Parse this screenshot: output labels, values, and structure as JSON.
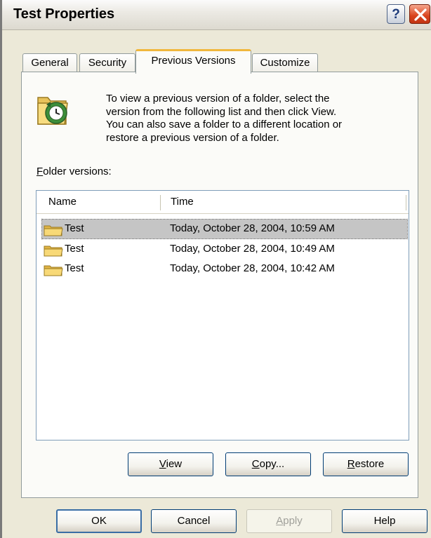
{
  "window": {
    "title": "Test Properties",
    "help_glyph": "?"
  },
  "tabs": [
    {
      "label": "General",
      "active": false
    },
    {
      "label": "Security",
      "active": false
    },
    {
      "label": "Previous Versions",
      "active": true
    },
    {
      "label": "Customize",
      "active": false
    }
  ],
  "panel": {
    "description_lines": [
      "To view a previous version of a folder, select the",
      "version from the following list and then click View.",
      "You can also save a folder to a different location or",
      "restore a previous version of a folder."
    ],
    "folder_versions_label_hotkey": "F",
    "folder_versions_label_rest": "older versions:",
    "columns": [
      "Name",
      "Time"
    ],
    "rows": [
      {
        "name": "Test",
        "time": "Today, October 28, 2004, 10:59 AM",
        "selected": true
      },
      {
        "name": "Test",
        "time": "Today, October 28, 2004, 10:49 AM",
        "selected": false
      },
      {
        "name": "Test",
        "time": "Today, October 28, 2004, 10:42 AM",
        "selected": false
      }
    ],
    "buttons": {
      "view_hotkey": "V",
      "view_rest": "iew",
      "copy_hotkey": "C",
      "copy_rest": "opy...",
      "restore_hotkey": "R",
      "restore_rest": "estore"
    }
  },
  "footer": {
    "ok": "OK",
    "cancel": "Cancel",
    "apply_hotkey": "A",
    "apply_rest": "pply",
    "help": "Help"
  },
  "colors": {
    "selection": "#c5c5c5",
    "active_tab_accent": "#f0b73d",
    "dialog_bg": "#ece9d8"
  },
  "icons": {
    "title_help": "help-icon",
    "title_close": "close-icon",
    "folder_restore": "folder-restore-icon",
    "folder": "folder-icon"
  }
}
